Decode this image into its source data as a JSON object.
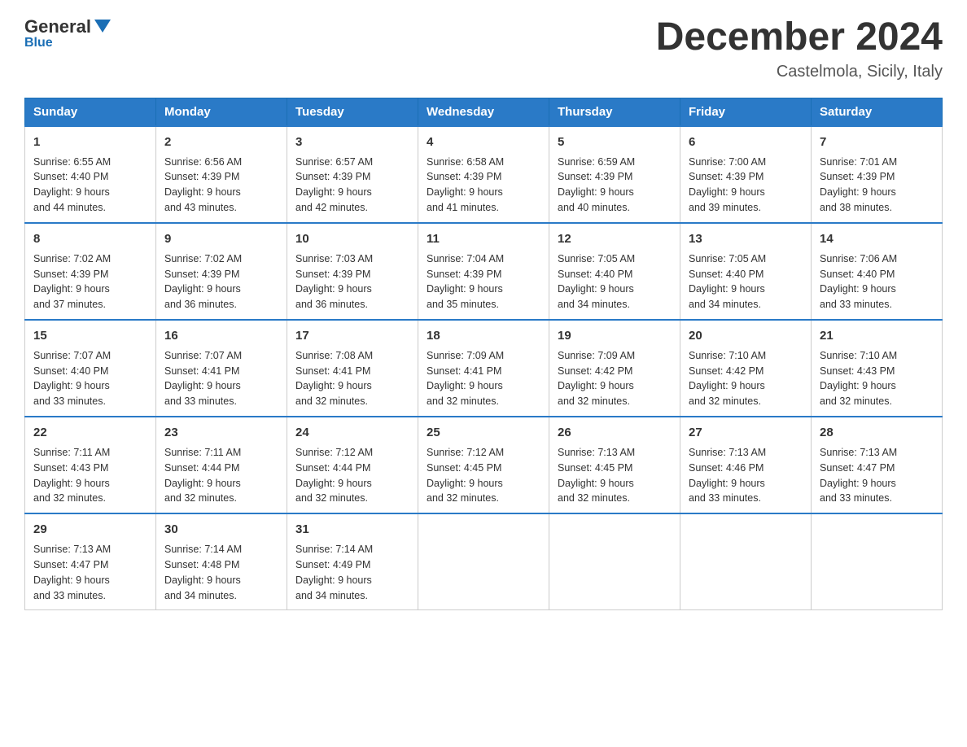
{
  "header": {
    "logo_general": "General",
    "logo_blue": "Blue",
    "month_title": "December 2024",
    "location": "Castelmola, Sicily, Italy"
  },
  "days_of_week": [
    "Sunday",
    "Monday",
    "Tuesday",
    "Wednesday",
    "Thursday",
    "Friday",
    "Saturday"
  ],
  "weeks": [
    [
      {
        "day": "1",
        "sunrise": "6:55 AM",
        "sunset": "4:40 PM",
        "daylight": "9 hours and 44 minutes."
      },
      {
        "day": "2",
        "sunrise": "6:56 AM",
        "sunset": "4:39 PM",
        "daylight": "9 hours and 43 minutes."
      },
      {
        "day": "3",
        "sunrise": "6:57 AM",
        "sunset": "4:39 PM",
        "daylight": "9 hours and 42 minutes."
      },
      {
        "day": "4",
        "sunrise": "6:58 AM",
        "sunset": "4:39 PM",
        "daylight": "9 hours and 41 minutes."
      },
      {
        "day": "5",
        "sunrise": "6:59 AM",
        "sunset": "4:39 PM",
        "daylight": "9 hours and 40 minutes."
      },
      {
        "day": "6",
        "sunrise": "7:00 AM",
        "sunset": "4:39 PM",
        "daylight": "9 hours and 39 minutes."
      },
      {
        "day": "7",
        "sunrise": "7:01 AM",
        "sunset": "4:39 PM",
        "daylight": "9 hours and 38 minutes."
      }
    ],
    [
      {
        "day": "8",
        "sunrise": "7:02 AM",
        "sunset": "4:39 PM",
        "daylight": "9 hours and 37 minutes."
      },
      {
        "day": "9",
        "sunrise": "7:02 AM",
        "sunset": "4:39 PM",
        "daylight": "9 hours and 36 minutes."
      },
      {
        "day": "10",
        "sunrise": "7:03 AM",
        "sunset": "4:39 PM",
        "daylight": "9 hours and 36 minutes."
      },
      {
        "day": "11",
        "sunrise": "7:04 AM",
        "sunset": "4:39 PM",
        "daylight": "9 hours and 35 minutes."
      },
      {
        "day": "12",
        "sunrise": "7:05 AM",
        "sunset": "4:40 PM",
        "daylight": "9 hours and 34 minutes."
      },
      {
        "day": "13",
        "sunrise": "7:05 AM",
        "sunset": "4:40 PM",
        "daylight": "9 hours and 34 minutes."
      },
      {
        "day": "14",
        "sunrise": "7:06 AM",
        "sunset": "4:40 PM",
        "daylight": "9 hours and 33 minutes."
      }
    ],
    [
      {
        "day": "15",
        "sunrise": "7:07 AM",
        "sunset": "4:40 PM",
        "daylight": "9 hours and 33 minutes."
      },
      {
        "day": "16",
        "sunrise": "7:07 AM",
        "sunset": "4:41 PM",
        "daylight": "9 hours and 33 minutes."
      },
      {
        "day": "17",
        "sunrise": "7:08 AM",
        "sunset": "4:41 PM",
        "daylight": "9 hours and 32 minutes."
      },
      {
        "day": "18",
        "sunrise": "7:09 AM",
        "sunset": "4:41 PM",
        "daylight": "9 hours and 32 minutes."
      },
      {
        "day": "19",
        "sunrise": "7:09 AM",
        "sunset": "4:42 PM",
        "daylight": "9 hours and 32 minutes."
      },
      {
        "day": "20",
        "sunrise": "7:10 AM",
        "sunset": "4:42 PM",
        "daylight": "9 hours and 32 minutes."
      },
      {
        "day": "21",
        "sunrise": "7:10 AM",
        "sunset": "4:43 PM",
        "daylight": "9 hours and 32 minutes."
      }
    ],
    [
      {
        "day": "22",
        "sunrise": "7:11 AM",
        "sunset": "4:43 PM",
        "daylight": "9 hours and 32 minutes."
      },
      {
        "day": "23",
        "sunrise": "7:11 AM",
        "sunset": "4:44 PM",
        "daylight": "9 hours and 32 minutes."
      },
      {
        "day": "24",
        "sunrise": "7:12 AM",
        "sunset": "4:44 PM",
        "daylight": "9 hours and 32 minutes."
      },
      {
        "day": "25",
        "sunrise": "7:12 AM",
        "sunset": "4:45 PM",
        "daylight": "9 hours and 32 minutes."
      },
      {
        "day": "26",
        "sunrise": "7:13 AM",
        "sunset": "4:45 PM",
        "daylight": "9 hours and 32 minutes."
      },
      {
        "day": "27",
        "sunrise": "7:13 AM",
        "sunset": "4:46 PM",
        "daylight": "9 hours and 33 minutes."
      },
      {
        "day": "28",
        "sunrise": "7:13 AM",
        "sunset": "4:47 PM",
        "daylight": "9 hours and 33 minutes."
      }
    ],
    [
      {
        "day": "29",
        "sunrise": "7:13 AM",
        "sunset": "4:47 PM",
        "daylight": "9 hours and 33 minutes."
      },
      {
        "day": "30",
        "sunrise": "7:14 AM",
        "sunset": "4:48 PM",
        "daylight": "9 hours and 34 minutes."
      },
      {
        "day": "31",
        "sunrise": "7:14 AM",
        "sunset": "4:49 PM",
        "daylight": "9 hours and 34 minutes."
      },
      null,
      null,
      null,
      null
    ]
  ]
}
